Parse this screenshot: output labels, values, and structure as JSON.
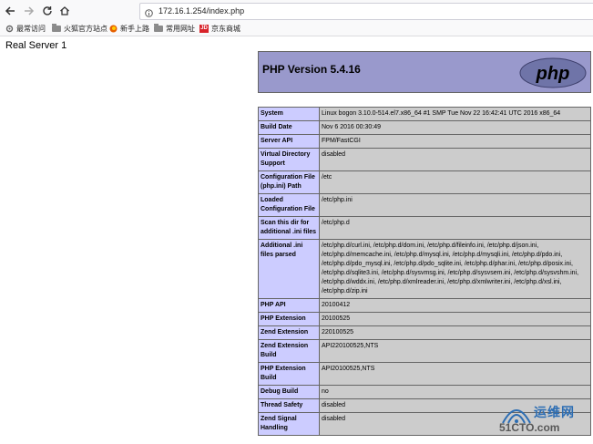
{
  "browser": {
    "url": "172.16.1.254/index.php",
    "bookmarks": [
      {
        "label": "最常访问",
        "icon": "gear-icon"
      },
      {
        "label": "火狐官方站点",
        "icon": "folder-icon"
      },
      {
        "label": "新手上路",
        "icon": "firefox-icon"
      },
      {
        "label": "常用网址",
        "icon": "folder-icon"
      },
      {
        "label": "京东商城",
        "icon": "jd-icon"
      }
    ],
    "jd_badge": "JD"
  },
  "page": {
    "server_title": "Real Server 1",
    "php_version": "PHP Version 5.4.16",
    "logo_text": "php",
    "rows": [
      {
        "k": "System",
        "v": "Linux bogon 3.10.0-514.el7.x86_64 #1 SMP Tue Nov 22 16:42:41 UTC 2016 x86_64"
      },
      {
        "k": "Build Date",
        "v": "Nov 6 2016 00:30:49"
      },
      {
        "k": "Server API",
        "v": "FPM/FastCGI"
      },
      {
        "k": "Virtual Directory Support",
        "v": "disabled"
      },
      {
        "k": "Configuration File (php.ini) Path",
        "v": "/etc"
      },
      {
        "k": "Loaded Configuration File",
        "v": "/etc/php.ini"
      },
      {
        "k": "Scan this dir for additional .ini files",
        "v": "/etc/php.d"
      },
      {
        "k": "Additional .ini files parsed",
        "v": "/etc/php.d/curl.ini, /etc/php.d/dom.ini, /etc/php.d/fileinfo.ini, /etc/php.d/json.ini, /etc/php.d/memcache.ini, /etc/php.d/mysql.ini, /etc/php.d/mysqli.ini, /etc/php.d/pdo.ini, /etc/php.d/pdo_mysql.ini, /etc/php.d/pdo_sqlite.ini, /etc/php.d/phar.ini, /etc/php.d/posix.ini, /etc/php.d/sqlite3.ini, /etc/php.d/sysvmsg.ini, /etc/php.d/sysvsem.ini, /etc/php.d/sysvshm.ini, /etc/php.d/wddx.ini, /etc/php.d/xmlreader.ini, /etc/php.d/xmlwriter.ini, /etc/php.d/xsl.ini, /etc/php.d/zip.ini"
      },
      {
        "k": "PHP API",
        "v": "20100412"
      },
      {
        "k": "PHP Extension",
        "v": "20100525"
      },
      {
        "k": "Zend Extension",
        "v": "220100525"
      },
      {
        "k": "Zend Extension Build",
        "v": "API220100525,NTS"
      },
      {
        "k": "PHP Extension Build",
        "v": "API20100525,NTS"
      },
      {
        "k": "Debug Build",
        "v": "no"
      },
      {
        "k": "Thread Safety",
        "v": "disabled"
      },
      {
        "k": "Zend Signal Handling",
        "v": "disabled"
      }
    ]
  },
  "watermark": {
    "cn": "运维网",
    "en": "51CTO.com"
  }
}
